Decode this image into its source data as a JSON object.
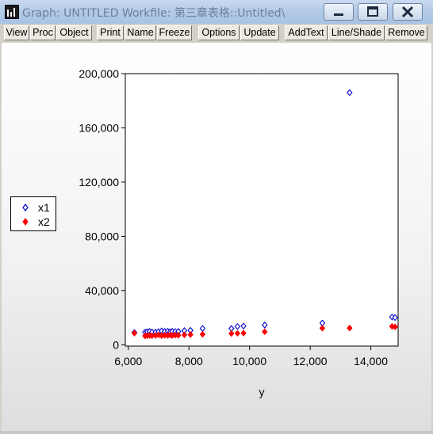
{
  "window": {
    "title": "Graph: UNTITLED   Workfile: 第三章表格::Untitled\\",
    "buttons": [
      "minimize-icon",
      "maximize-icon",
      "close-icon"
    ]
  },
  "toolbar": {
    "items": [
      "View",
      "Proc",
      "Object",
      "Print",
      "Name",
      "Freeze",
      "Options",
      "Update",
      "AddText",
      "Line/Shade",
      "Remove"
    ]
  },
  "chart_data": {
    "type": "scatter",
    "title": "",
    "xlabel": "y",
    "ylabel": "",
    "xlim": [
      5900,
      14900
    ],
    "ylim": [
      -1000,
      200000
    ],
    "x_ticks": [
      "6,000",
      "8,000",
      "10,000",
      "12,000",
      "14,000"
    ],
    "y_ticks": [
      "0",
      "40,000",
      "80,000",
      "120,000",
      "160,000",
      "200,000"
    ],
    "x_tick_values": [
      6000,
      8000,
      10000,
      12000,
      14000
    ],
    "y_tick_values": [
      0,
      40000,
      80000,
      120000,
      160000,
      200000
    ],
    "legend": {
      "placement": "left",
      "entries": [
        "x1",
        "x2"
      ]
    },
    "series": [
      {
        "name": "x1",
        "marker": "diamond-open",
        "color": "#0000cc",
        "points": [
          [
            6200,
            9000
          ],
          [
            6550,
            9200
          ],
          [
            6620,
            9600
          ],
          [
            6700,
            9800
          ],
          [
            6780,
            9400
          ],
          [
            6900,
            9300
          ],
          [
            7000,
            9700
          ],
          [
            7100,
            10200
          ],
          [
            7200,
            9800
          ],
          [
            7300,
            10000
          ],
          [
            7380,
            9600
          ],
          [
            7450,
            9900
          ],
          [
            7550,
            9700
          ],
          [
            7650,
            9800
          ],
          [
            7850,
            10400
          ],
          [
            8050,
            10600
          ],
          [
            8450,
            12000
          ],
          [
            9400,
            12000
          ],
          [
            9600,
            13500
          ],
          [
            9800,
            13800
          ],
          [
            10500,
            14500
          ],
          [
            12400,
            16000
          ],
          [
            13300,
            186000
          ],
          [
            14700,
            20500
          ],
          [
            14800,
            20000
          ]
        ]
      },
      {
        "name": "x2",
        "marker": "diamond-filled",
        "color": "#ff0000",
        "points": [
          [
            6200,
            8500
          ],
          [
            6550,
            6500
          ],
          [
            6620,
            6700
          ],
          [
            6700,
            6900
          ],
          [
            6780,
            6600
          ],
          [
            6900,
            6800
          ],
          [
            7000,
            7200
          ],
          [
            7100,
            6700
          ],
          [
            7200,
            7000
          ],
          [
            7300,
            6900
          ],
          [
            7380,
            7200
          ],
          [
            7450,
            6800
          ],
          [
            7550,
            7100
          ],
          [
            7650,
            7000
          ],
          [
            7850,
            7300
          ],
          [
            8050,
            7500
          ],
          [
            8450,
            7700
          ],
          [
            9400,
            8300
          ],
          [
            9600,
            8400
          ],
          [
            9800,
            8600
          ],
          [
            10500,
            9600
          ],
          [
            12400,
            12200
          ],
          [
            13300,
            12300
          ],
          [
            14700,
            13500
          ],
          [
            14800,
            13200
          ]
        ]
      }
    ]
  }
}
